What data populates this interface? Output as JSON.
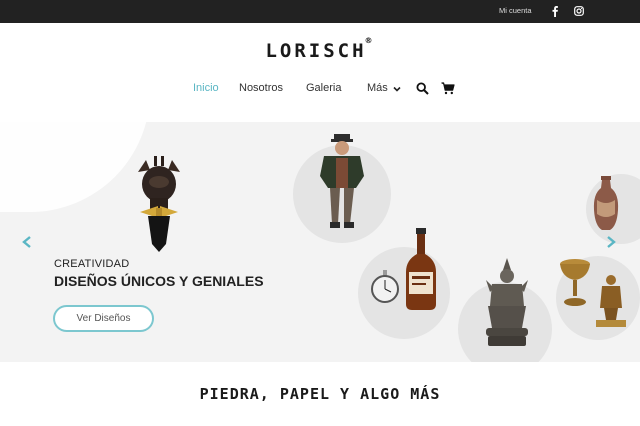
{
  "topbar": {
    "account_label": "Mi cuenta",
    "social": [
      "facebook-icon",
      "instagram-icon"
    ]
  },
  "header": {
    "logo": "LORISCH",
    "logo_mark": "®"
  },
  "nav": {
    "items": [
      "Inicio",
      "Nosotros",
      "Galeria",
      "Más"
    ],
    "active": "Inicio",
    "accent_color": "#5ab6c4"
  },
  "hero": {
    "subtitle": "CREATIVIDAD",
    "title": "DISEÑOS ÚNICOS Y GENIALES",
    "button_label": "Ver Diseños",
    "button_border_color": "#7cc7cf"
  },
  "section": {
    "title": "PIEDRA, PAPEL Y ALGO MÁS"
  }
}
